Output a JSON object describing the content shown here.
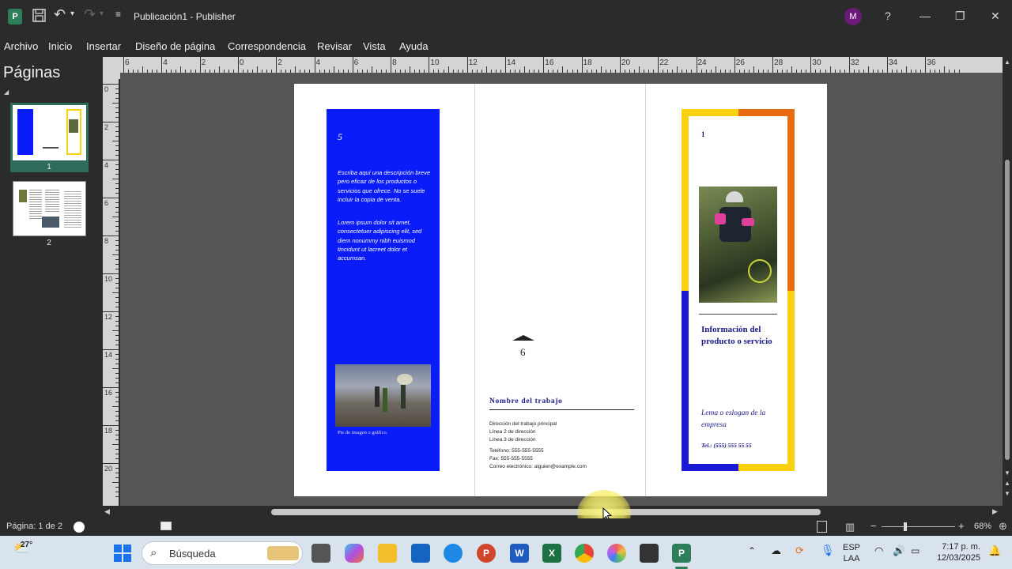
{
  "window": {
    "title": "Publicación1  -  Publisher",
    "app_icon": "P",
    "avatar_initial": "M",
    "help": "?",
    "minimize": "—",
    "restore": "❐",
    "close": "✕"
  },
  "menu": [
    "Archivo",
    "Inicio",
    "Insertar",
    "Diseño de página",
    "Correspondencia",
    "Revisar",
    "Vista",
    "Ayuda"
  ],
  "pages_pane": {
    "title": "Páginas",
    "pages": [
      {
        "label": "1"
      },
      {
        "label": "2"
      }
    ]
  },
  "ruler": {
    "h_labels": [
      "6",
      "4",
      "2",
      "0",
      "2",
      "4",
      "6",
      "8",
      "10",
      "12",
      "14",
      "16",
      "18",
      "20",
      "22",
      "24",
      "26",
      "28",
      "30",
      "32",
      "34",
      "36"
    ],
    "v_labels": [
      "0",
      "2",
      "4",
      "6",
      "8",
      "10",
      "12",
      "14",
      "16",
      "18",
      "20"
    ]
  },
  "brochure": {
    "left_panel": {
      "page_number": "5",
      "description": "Escriba aquí una descripción breve pero eficaz de los productos o servicios que ofrece. No se suele incluir la copia de venta.",
      "lorem": "Lorem ipsum dolor sit amet, consectetuer adipiscing elit, sed diem nonummy nibh euismod tincidunt ut lacreet dolor et accumsan.",
      "caption": "Pie de imagen o gráfico.",
      "bg_color": "#0a1cf7"
    },
    "middle_panel": {
      "page_number": "6",
      "job_name": "Nombre del trabajo",
      "address_lines": [
        "Dirección del trabajo principal",
        "Línea 2 de dirección",
        "Línea 3 de dirección"
      ],
      "contact_lines": [
        "Teléfono: 555-555-5555",
        "Fax: 555-555-5555",
        "Correo electrónico: alguien@example.com"
      ]
    },
    "right_panel": {
      "page_number": "1",
      "heading": "Información del producto o servicio",
      "slogan": "Lema o eslogan de la empresa",
      "phone": "Tel.: (555) 555 55 55",
      "colors": {
        "yellow": "#f9d10f",
        "orange": "#e96b10",
        "blue": "#1a1ad6",
        "heading": "#1a1a8c"
      }
    }
  },
  "status": {
    "page_indicator": "Página: 1 de 2",
    "zoom": "68%",
    "zoom_minus": "−",
    "zoom_plus": "+"
  },
  "taskbar": {
    "weather": "27°",
    "search_placeholder": "Búsqueda",
    "lang_line1": "ESP",
    "lang_line2": "LAA",
    "time": "7:17 p. m.",
    "date": "12/03/2025"
  }
}
